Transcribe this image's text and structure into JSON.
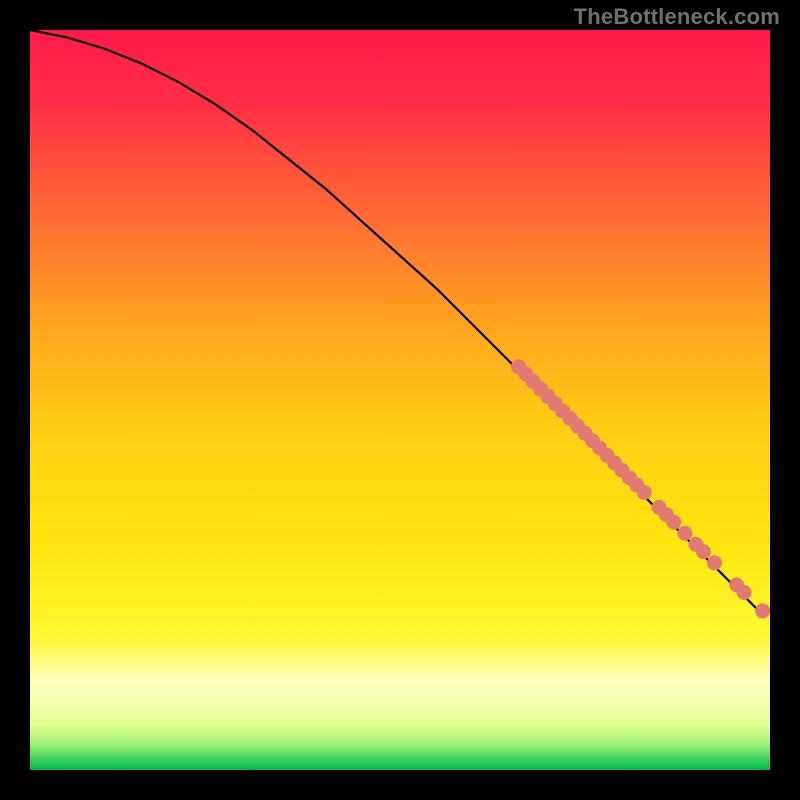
{
  "watermark": {
    "text": "TheBottleneck.com"
  },
  "plot": {
    "gradient_stops": [
      {
        "offset": 0.0,
        "color": "#ff1a4a"
      },
      {
        "offset": 0.1,
        "color": "#ff2e46"
      },
      {
        "offset": 0.25,
        "color": "#ff6a35"
      },
      {
        "offset": 0.4,
        "color": "#ffa51f"
      },
      {
        "offset": 0.55,
        "color": "#ffd014"
      },
      {
        "offset": 0.7,
        "color": "#ffe60f"
      },
      {
        "offset": 0.82,
        "color": "#fff833"
      },
      {
        "offset": 0.88,
        "color": "#ffffc0"
      },
      {
        "offset": 0.91,
        "color": "#f6ffb0"
      },
      {
        "offset": 0.94,
        "color": "#e0ff90"
      },
      {
        "offset": 0.965,
        "color": "#a0f078"
      },
      {
        "offset": 0.985,
        "color": "#40d060"
      },
      {
        "offset": 1.0,
        "color": "#00b84a"
      }
    ]
  },
  "chart_data": {
    "type": "line",
    "title": "",
    "xlabel": "",
    "ylabel": "",
    "xlim": [
      0,
      100
    ],
    "ylim": [
      0,
      100
    ],
    "series": [
      {
        "name": "curve",
        "x": [
          0,
          5,
          10,
          15,
          20,
          25,
          30,
          35,
          40,
          45,
          50,
          55,
          60,
          65,
          70,
          75,
          80,
          85,
          90,
          95,
          99
        ],
        "y": [
          100,
          99,
          97.5,
          95.5,
          93,
          90,
          86.5,
          82.5,
          78.5,
          74,
          69.5,
          65,
          60,
          55,
          50,
          45,
          40,
          35,
          30,
          25,
          21
        ]
      }
    ],
    "markers": {
      "name": "dense-band",
      "color": "#e07a72",
      "points": [
        {
          "x": 66,
          "y": 54.5
        },
        {
          "x": 67,
          "y": 53.5
        },
        {
          "x": 68,
          "y": 52.5
        },
        {
          "x": 69,
          "y": 51.5
        },
        {
          "x": 70,
          "y": 50.5
        },
        {
          "x": 71,
          "y": 49.5
        },
        {
          "x": 72,
          "y": 48.5
        },
        {
          "x": 73,
          "y": 47.5
        },
        {
          "x": 74,
          "y": 46.5
        },
        {
          "x": 75,
          "y": 45.5
        },
        {
          "x": 76,
          "y": 44.5
        },
        {
          "x": 77,
          "y": 43.5
        },
        {
          "x": 78,
          "y": 42.5
        },
        {
          "x": 79,
          "y": 41.5
        },
        {
          "x": 80,
          "y": 40.5
        },
        {
          "x": 81,
          "y": 39.5
        },
        {
          "x": 82,
          "y": 38.5
        },
        {
          "x": 83,
          "y": 37.5
        },
        {
          "x": 85,
          "y": 35.5
        },
        {
          "x": 86,
          "y": 34.5
        },
        {
          "x": 87,
          "y": 33.5
        },
        {
          "x": 88.5,
          "y": 32
        },
        {
          "x": 90,
          "y": 30.5
        },
        {
          "x": 91,
          "y": 29.5
        },
        {
          "x": 92.5,
          "y": 28
        },
        {
          "x": 95.5,
          "y": 25
        },
        {
          "x": 96.5,
          "y": 24
        },
        {
          "x": 99,
          "y": 21.5
        }
      ]
    }
  }
}
